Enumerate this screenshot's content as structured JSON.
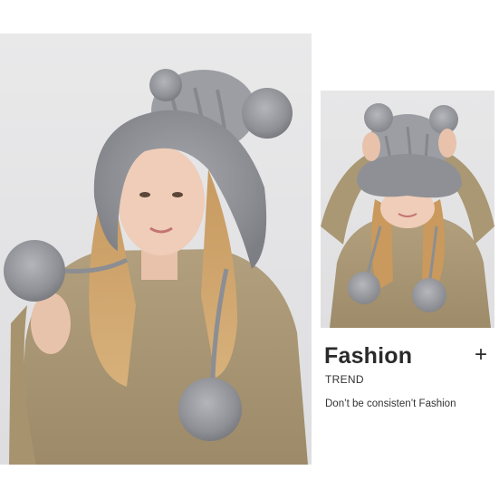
{
  "product": {
    "main_image": "woman-wearing-grey-fur-trim-bear-ear-knit-hat-with-pompom-ties",
    "side_image": "woman-holding-grey-bear-ear-knit-hat-with-fur-brim",
    "colors": {
      "hat_fur": "#8f9196",
      "hat_knit": "#9c9ea3",
      "sweater": "#a89674",
      "hair": "#c8995e",
      "background": "#e4e4e6"
    }
  },
  "caption": {
    "title": "Fashion",
    "subtitle": "TREND",
    "tagline": "Don’t be consisten’t Fashion",
    "action_icon": "plus-icon",
    "action_symbol": "+"
  }
}
